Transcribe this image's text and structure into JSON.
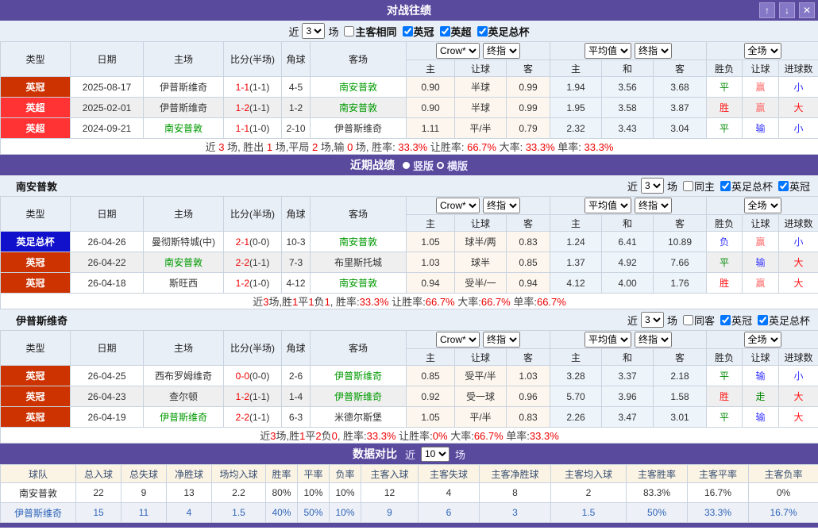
{
  "colors": {
    "bar_purple": "#5A4A9E",
    "button_purple": "#8477C5",
    "badge_yingguan": "#CC3300",
    "badge_yingchao": "#FF3333",
    "badge_yingzuzongbei": "#1111CC",
    "team_green": "#009900",
    "score_red": "#EE0000",
    "win_red": "#FF1111",
    "draw_green": "#008800",
    "lose_blue": "#3333FF",
    "handicap_win_salmon": "#FF6A6A",
    "header_blue_bg": "#E9EFF7",
    "crow_col_bg": "#FDF6EE",
    "avg_col_bg": "#EDF4FA",
    "cmp_header_bg": "#FBF4E4"
  },
  "window_controls": {
    "up": "↑",
    "down": "↓",
    "close": "✕"
  },
  "match_headers": {
    "type": "类型",
    "date": "日期",
    "home": "主场",
    "score": "比分(半场)",
    "corner": "角球",
    "away": "客场",
    "sel_crow": "Crow*",
    "sel_final": "终指",
    "sel_avg": "平均值",
    "sel_full": "全场",
    "odds_home": "主",
    "odds_hcp": "让球",
    "odds_away": "客",
    "eu_home": "主",
    "eu_draw": "和",
    "eu_away": "客",
    "result": "胜负",
    "hcp_result": "让球",
    "goals": "进球数"
  },
  "h2h": {
    "title": "对战往绩",
    "filter": {
      "near": "近",
      "games": "3",
      "field": "场",
      "cb_same": "主客相同",
      "cb_l1": "英冠",
      "cb_l1_checked": "checked",
      "cb_l2": "英超",
      "cb_l2_checked": "checked",
      "cb_l3": "英足总杯",
      "cb_l3_checked": "checked"
    },
    "rows": [
      {
        "league": "英冠",
        "date": "2025-08-17",
        "home": "伊普斯维奇",
        "score": "1-1",
        "half": "(1-1)",
        "corner": "4-5",
        "away": "南安普敦",
        "o1": "0.90",
        "o2": "半球",
        "o3": "0.99",
        "e1": "1.94",
        "e2": "3.56",
        "e3": "3.68",
        "res": "平",
        "hres": "赢",
        "goals": "小"
      },
      {
        "league": "英超",
        "date": "2025-02-01",
        "home": "伊普斯维奇",
        "score": "1-2",
        "half": "(1-1)",
        "corner": "1-2",
        "away": "南安普敦",
        "o1": "0.90",
        "o2": "半球",
        "o3": "0.99",
        "e1": "1.95",
        "e2": "3.58",
        "e3": "3.87",
        "res": "胜",
        "hres": "赢",
        "goals": "大"
      },
      {
        "league": "英超",
        "date": "2024-09-21",
        "home": "南安普敦",
        "score": "1-1",
        "half": "(1-0)",
        "corner": "2-10",
        "away": "伊普斯维奇",
        "o1": "1.11",
        "o2": "平/半",
        "o3": "0.79",
        "e1": "2.32",
        "e2": "3.43",
        "e3": "3.04",
        "res": "平",
        "hres": "输",
        "goals": "小"
      }
    ],
    "summary": {
      "l1": "近 ",
      "v1": "3",
      "l2": " 场, 胜出 ",
      "v2": "1",
      "l3": " 场,平局 ",
      "v3": "2",
      "l4": " 场,输 ",
      "v4": "0",
      "l5": " 场, 胜率: ",
      "v5": "33.3%",
      "l6": " 让胜率: ",
      "v6": "66.7%",
      "l7": " 大率: ",
      "v7": "33.3%",
      "l8": " 单率: ",
      "v8": "33.3%"
    }
  },
  "recent": {
    "title": "近期战绩",
    "view_vertical": "竖版",
    "view_horizontal": "横版",
    "south": {
      "team": "南安普敦",
      "filter": {
        "near": "近",
        "games": "3",
        "field": "场",
        "cb_same": "同主",
        "cb_l1": "英足总杯",
        "cb_l1_checked": "checked",
        "cb_l2": "英冠",
        "cb_l2_checked": "checked"
      },
      "rows": [
        {
          "league": "英足总杯",
          "date": "26-04-26",
          "home": "曼彻斯特城(中)",
          "score": "2-1",
          "half": "(0-0)",
          "corner": "10-3",
          "away": "南安普敦",
          "o1": "1.05",
          "o2": "球半/两",
          "o3": "0.83",
          "e1": "1.24",
          "e2": "6.41",
          "e3": "10.89",
          "res": "负",
          "hres": "赢",
          "goals": "小"
        },
        {
          "league": "英冠",
          "date": "26-04-22",
          "home": "南安普敦",
          "score": "2-2",
          "half": "(1-1)",
          "corner": "7-3",
          "away": "布里斯托城",
          "o1": "1.03",
          "o2": "球半",
          "o3": "0.85",
          "e1": "1.37",
          "e2": "4.92",
          "e3": "7.66",
          "res": "平",
          "hres": "输",
          "goals": "大"
        },
        {
          "league": "英冠",
          "date": "26-04-18",
          "home": "斯旺西",
          "score": "1-2",
          "half": "(1-0)",
          "corner": "4-12",
          "away": "南安普敦",
          "o1": "0.94",
          "o2": "受半/一",
          "o3": "0.94",
          "e1": "4.12",
          "e2": "4.00",
          "e3": "1.76",
          "res": "胜",
          "hres": "赢",
          "goals": "大"
        }
      ],
      "summary": {
        "l1": "近",
        "v1": "3",
        "l2": "场,胜",
        "v2": "1",
        "l3": "平",
        "v3": "1",
        "l4": "负",
        "v4": "1",
        "l5": ", 胜率:",
        "v5": "33.3%",
        "l6": " 让胜率:",
        "v6": "66.7%",
        "l7": " 大率:",
        "v7": "66.7%",
        "l8": " 单率:",
        "v8": "66.7%"
      }
    },
    "ips": {
      "team": "伊普斯维奇",
      "filter": {
        "near": "近",
        "games": "3",
        "field": "场",
        "cb_same": "同客",
        "cb_l1": "英冠",
        "cb_l1_checked": "checked",
        "cb_l2": "英足总杯",
        "cb_l2_checked": "checked"
      },
      "rows": [
        {
          "league": "英冠",
          "date": "26-04-25",
          "home": "西布罗姆维奇",
          "score": "0-0",
          "half": "(0-0)",
          "corner": "2-6",
          "away": "伊普斯维奇",
          "o1": "0.85",
          "o2": "受平/半",
          "o3": "1.03",
          "e1": "3.28",
          "e2": "3.37",
          "e3": "2.18",
          "res": "平",
          "hres": "输",
          "goals": "小"
        },
        {
          "league": "英冠",
          "date": "26-04-23",
          "home": "查尔顿",
          "score": "1-2",
          "half": "(1-1)",
          "corner": "1-4",
          "away": "伊普斯维奇",
          "o1": "0.92",
          "o2": "受一球",
          "o3": "0.96",
          "e1": "5.70",
          "e2": "3.96",
          "e3": "1.58",
          "res": "胜",
          "hres": "走",
          "goals": "大"
        },
        {
          "league": "英冠",
          "date": "26-04-19",
          "home": "伊普斯维奇",
          "score": "2-2",
          "half": "(1-1)",
          "corner": "6-3",
          "away": "米德尔斯堡",
          "o1": "1.05",
          "o2": "平/半",
          "o3": "0.83",
          "e1": "2.26",
          "e2": "3.47",
          "e3": "3.01",
          "res": "平",
          "hres": "输",
          "goals": "大"
        }
      ],
      "summary": {
        "l1": "近",
        "v1": "3",
        "l2": "场,胜",
        "v2": "1",
        "l3": "平",
        "v3": "2",
        "l4": "负",
        "v4": "0",
        "l5": ", 胜率:",
        "v5": "33.3%",
        "l6": " 让胜率:",
        "v6": "0%",
        "l7": " 大率:",
        "v7": "66.7%",
        "l8": " 单率:",
        "v8": "33.3%"
      }
    }
  },
  "compare": {
    "title": "数据对比",
    "near": "近",
    "games": "10",
    "field": "场",
    "headers": [
      "球队",
      "总入球",
      "总失球",
      "净胜球",
      "场均入球",
      "胜率",
      "平率",
      "负率",
      "主客入球",
      "主客失球",
      "主客净胜球",
      "主客均入球",
      "主客胜率",
      "主客平率",
      "主客负率"
    ],
    "rows": [
      {
        "cells": [
          "南安普敦",
          "22",
          "9",
          "13",
          "2.2",
          "80%",
          "10%",
          "10%",
          "12",
          "4",
          "8",
          "2",
          "83.3%",
          "16.7%",
          "0%"
        ]
      },
      {
        "cells": [
          "伊普斯维奇",
          "15",
          "11",
          "4",
          "1.5",
          "40%",
          "50%",
          "10%",
          "9",
          "6",
          "3",
          "1.5",
          "50%",
          "33.3%",
          "16.7%"
        ]
      }
    ]
  }
}
